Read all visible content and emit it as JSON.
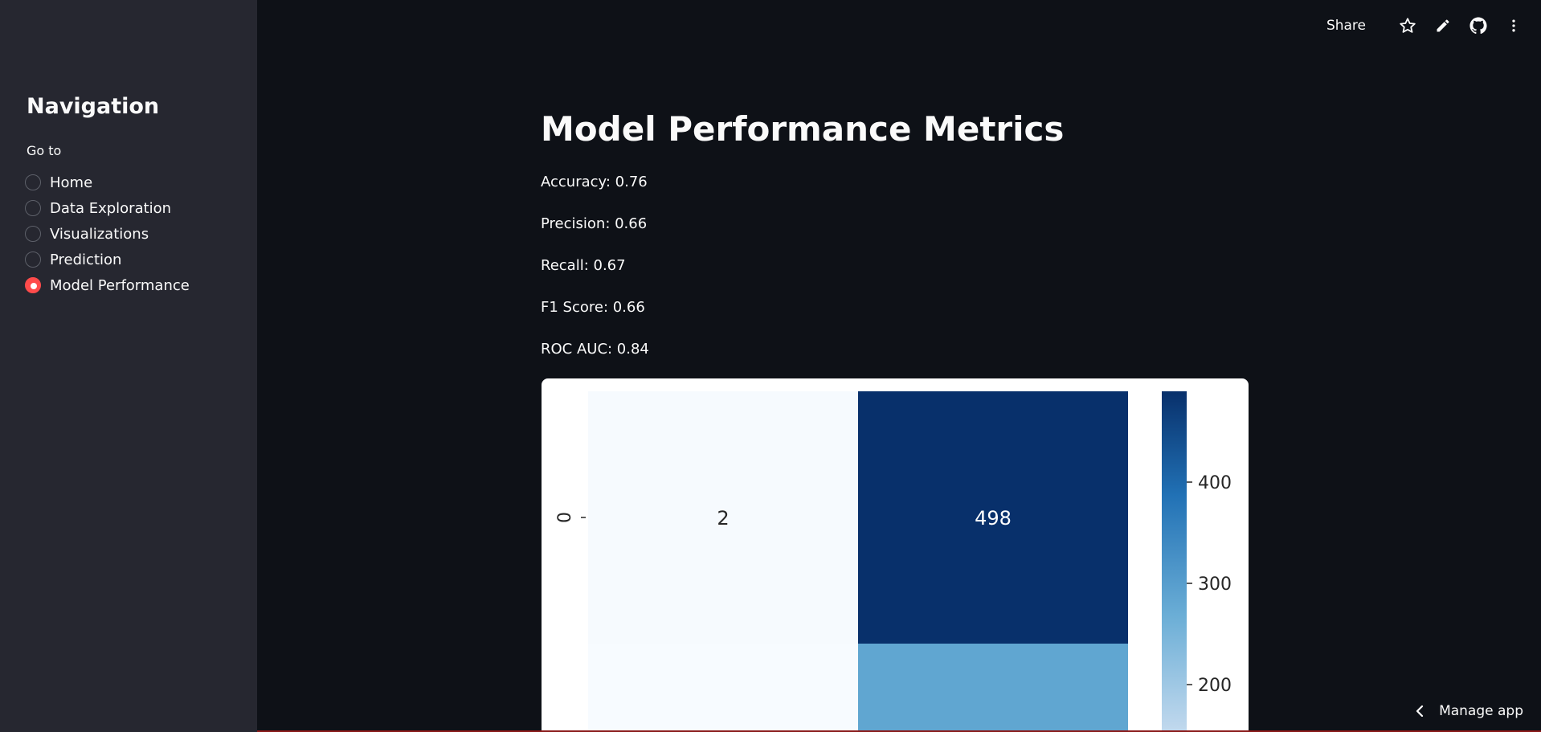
{
  "sidebar": {
    "title": "Navigation",
    "goto_label": "Go to",
    "items": [
      {
        "label": "Home",
        "selected": false
      },
      {
        "label": "Data Exploration",
        "selected": false
      },
      {
        "label": "Visualizations",
        "selected": false
      },
      {
        "label": "Prediction",
        "selected": false
      },
      {
        "label": "Model Performance",
        "selected": true
      }
    ]
  },
  "toolbar": {
    "share_label": "Share",
    "icons": [
      "star-icon",
      "pencil-icon",
      "github-icon",
      "kebab-menu-icon"
    ]
  },
  "main": {
    "title": "Model Performance Metrics",
    "metrics": [
      "Accuracy: 0.76",
      "Precision: 0.66",
      "Recall: 0.67",
      "F1 Score: 0.66",
      "ROC AUC: 0.84"
    ]
  },
  "chart_data": {
    "type": "heatmap",
    "title": "",
    "row_labels": [
      "0"
    ],
    "cells": [
      {
        "row": 0,
        "col": 0,
        "value": 2,
        "label": "2"
      },
      {
        "row": 0,
        "col": 1,
        "value": 498,
        "label": "498"
      }
    ],
    "colorbar": {
      "colormap": "Blues",
      "ticks": [
        "400",
        "300",
        "200"
      ],
      "tick_values": [
        400,
        300,
        200
      ],
      "vmax": 498
    },
    "colors": {
      "low": "#f7fbff",
      "high": "#08306b",
      "mid": "#60a6d1"
    }
  },
  "footer": {
    "manage_app_label": "Manage app"
  },
  "colors": {
    "accent": "#ff4b4b",
    "sidebar_bg": "#262730",
    "main_bg": "#0e1117"
  }
}
